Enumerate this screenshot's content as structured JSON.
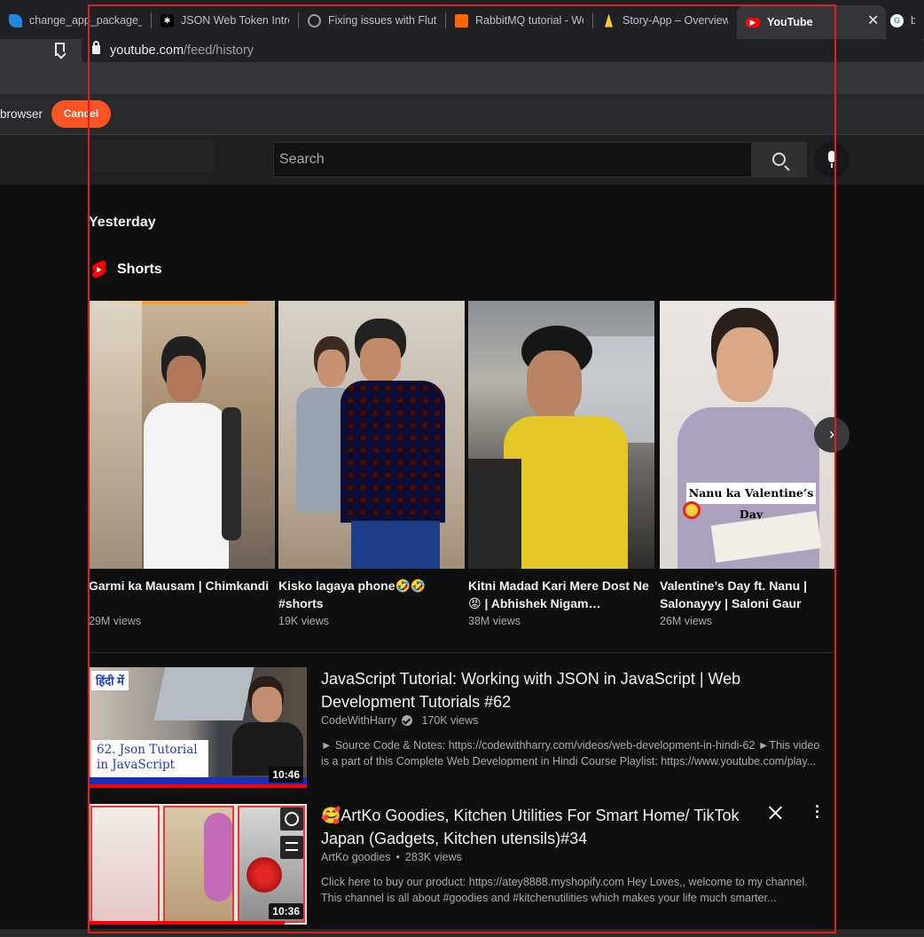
{
  "browser": {
    "tabs": [
      {
        "title": "change_app_package_na",
        "icon": "flutter-icon"
      },
      {
        "title": "JSON Web Token Introd",
        "icon": "jwt-icon"
      },
      {
        "title": "Fixing issues with Flutter",
        "icon": "globe-icon"
      },
      {
        "title": "RabbitMQ tutorial - Wor",
        "icon": "rabbitmq-icon"
      },
      {
        "title": "Story-App – Overview –",
        "icon": "firebase-icon"
      },
      {
        "title": "YouTube",
        "icon": "youtube-icon"
      },
      {
        "title": "ba",
        "icon": "google-icon"
      }
    ],
    "url_host": "youtube.com",
    "url_path": "/feed/history",
    "infobar_text": "browser",
    "cancel_label": "Cancel"
  },
  "masthead": {
    "search_placeholder": "Search"
  },
  "history": {
    "date_heading": "Yesterday",
    "shorts_label": "Shorts",
    "shorts": [
      {
        "title": "Garmi ka Mausam | Chimkandi",
        "views": "29M views"
      },
      {
        "title": "Kisko lagaya phone🤣🤣 #shorts",
        "views": "19K views"
      },
      {
        "title": "Kitni Madad Kari Mere Dost Ne 😡 | Abhishek Nigam…",
        "views": "38M views"
      },
      {
        "title": "Valentine’s Day ft. Nanu | Salonayyy | Saloni Gaur",
        "views": "26M views",
        "overlay_text": "Nanu ka Valentine’s Day"
      }
    ],
    "videos": [
      {
        "title": "JavaScript Tutorial: Working with JSON in JavaScript | Web Development Tutorials #62",
        "channel": "CodeWithHarry",
        "verified": true,
        "views": "170K views",
        "description": "► Source Code & Notes: https://codewithharry.com/videos/web-development-in-hindi-62 ►This video is a part of this Complete Web Development in Hindi Course Playlist: https://www.youtube.com/play...",
        "duration": "10:46",
        "progress": 1.0,
        "thumb_text_top": "हिंदी में",
        "thumb_text_main": "62. Json Tutorial in JavaScript"
      },
      {
        "title": "🥰ArtKo Goodies, Kitchen Utilities For Smart Home/ TikTok Japan (Gadgets, Kitchen utensils)#34",
        "channel": "ArtKo goodies",
        "verified": false,
        "views": "283K views",
        "description": "Click here to buy our product: https://atey8888.myshopify.com Hey Loves,, welcome to my channel. This channel is all about #goodies and #kitchenutilities which makes your life much smarter...",
        "duration": "10:36",
        "progress": 0.9
      }
    ]
  },
  "colors": {
    "accent": "#fb5424",
    "youtube_red": "#ff0000",
    "background": "#0f0f0f"
  }
}
